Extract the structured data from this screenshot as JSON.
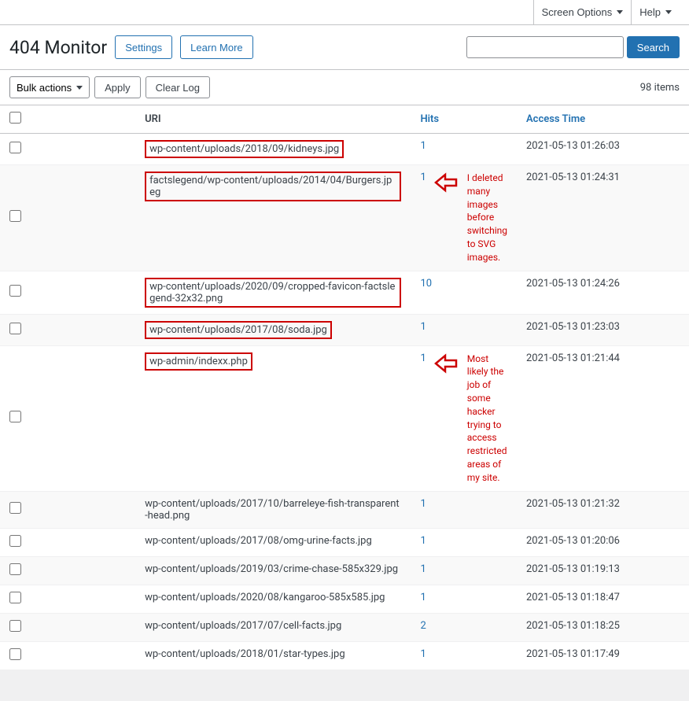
{
  "topbar": {
    "screen_options_label": "Screen Options",
    "help_label": "Help"
  },
  "header": {
    "title": "404 Monitor",
    "settings_label": "Settings",
    "learn_more_label": "Learn More"
  },
  "search": {
    "placeholder": "",
    "button_label": "Search"
  },
  "toolbar": {
    "bulk_actions_label": "Bulk actions",
    "apply_label": "Apply",
    "clear_log_label": "Clear Log",
    "items_count": "98 items"
  },
  "table": {
    "col_uri": "URI",
    "col_hits": "Hits",
    "col_access": "Access Time",
    "rows": [
      {
        "uri": "wp-content/uploads/2018/09/kidneys.jpg",
        "hits": "1",
        "access_time": "2021-05-13 01:26:03",
        "highlighted": true,
        "annotation": null
      },
      {
        "uri": "factslegend/wp-content/uploads/2014/04/Burgers.jpeg",
        "hits": "1",
        "access_time": "2021-05-13 01:24:31",
        "highlighted": true,
        "annotation": "I deleted many images before switching to SVG images."
      },
      {
        "uri": "wp-content/uploads/2020/09/cropped-favicon-factslegend-32x32.png",
        "hits": "10",
        "access_time": "2021-05-13 01:24:26",
        "highlighted": true,
        "annotation": null
      },
      {
        "uri": "wp-content/uploads/2017/08/soda.jpg",
        "hits": "1",
        "access_time": "2021-05-13 01:23:03",
        "highlighted": true,
        "annotation": null
      },
      {
        "uri": "wp-admin/indexx.php",
        "hits": "1",
        "access_time": "2021-05-13 01:21:44",
        "highlighted": true,
        "annotation": "Most likely the job of some hacker trying to access restricted areas of my site."
      },
      {
        "uri": "wp-content/uploads/2017/10/barreleye-fish-transparent-head.png",
        "hits": "1",
        "access_time": "2021-05-13 01:21:32",
        "highlighted": false,
        "annotation": null
      },
      {
        "uri": "wp-content/uploads/2017/08/omg-urine-facts.jpg",
        "hits": "1",
        "access_time": "2021-05-13 01:20:06",
        "highlighted": false,
        "annotation": null
      },
      {
        "uri": "wp-content/uploads/2019/03/crime-chase-585x329.jpg",
        "hits": "1",
        "access_time": "2021-05-13 01:19:13",
        "highlighted": false,
        "annotation": null
      },
      {
        "uri": "wp-content/uploads/2020/08/kangaroo-585x585.jpg",
        "hits": "1",
        "access_time": "2021-05-13 01:18:47",
        "highlighted": false,
        "annotation": null
      },
      {
        "uri": "wp-content/uploads/2017/07/cell-facts.jpg",
        "hits": "2",
        "access_time": "2021-05-13 01:18:25",
        "highlighted": false,
        "annotation": null
      },
      {
        "uri": "wp-content/uploads/2018/01/star-types.jpg",
        "hits": "1",
        "access_time": "2021-05-13 01:17:49",
        "highlighted": false,
        "annotation": null
      }
    ]
  }
}
